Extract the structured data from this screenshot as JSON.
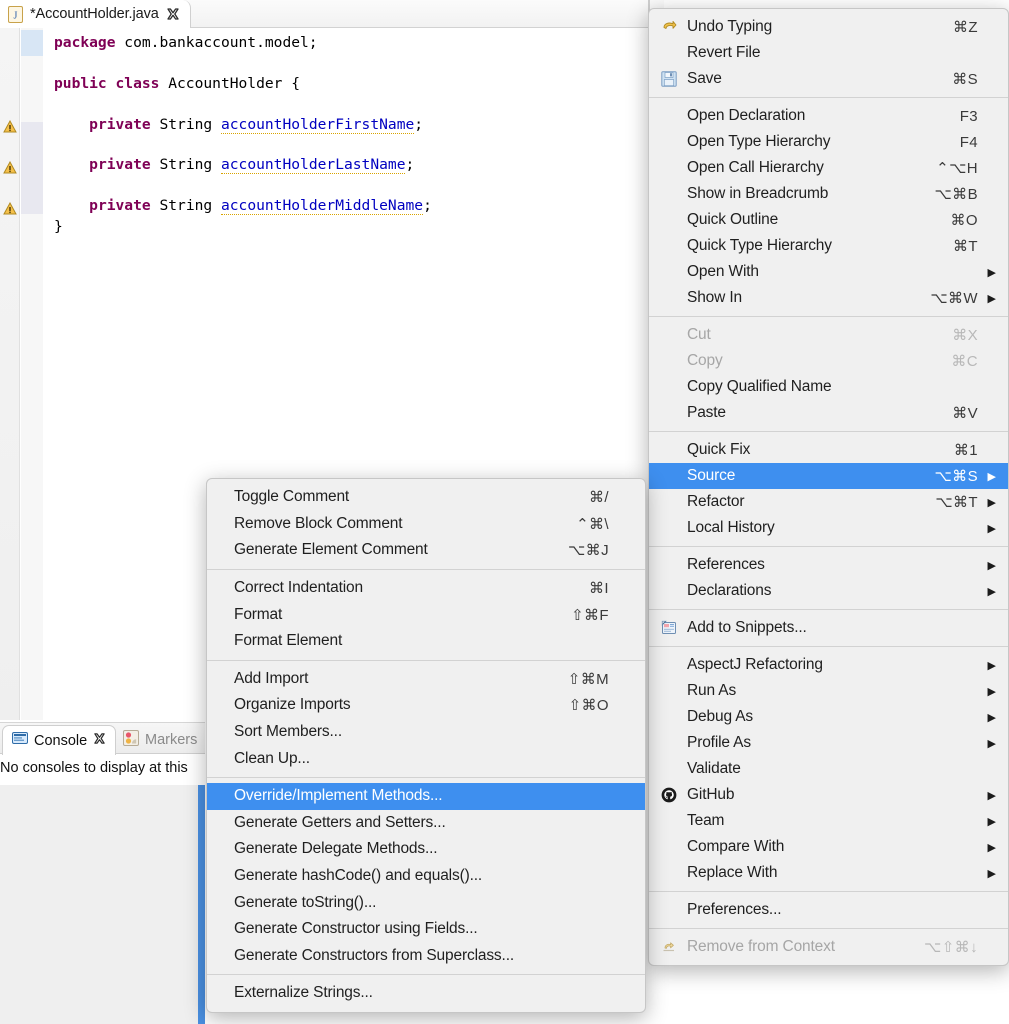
{
  "editor": {
    "tab": {
      "title": "*AccountHolder.java",
      "close_icon": "close-x-icon",
      "file_icon": "java-file-icon"
    },
    "code_lines": [
      {
        "id": "l1",
        "segments": [
          {
            "t": "kw",
            "s": "package"
          },
          {
            "t": "p",
            "s": " com.bankaccount.model;"
          }
        ]
      },
      {
        "id": "l2",
        "segments": []
      },
      {
        "id": "l3",
        "segments": [
          {
            "t": "kw",
            "s": "public class"
          },
          {
            "t": "p",
            "s": " AccountHolder {"
          }
        ]
      },
      {
        "id": "l4",
        "segments": []
      },
      {
        "id": "l5",
        "segments": [
          {
            "t": "p",
            "s": "    "
          },
          {
            "t": "kw",
            "s": "private"
          },
          {
            "t": "p",
            "s": " String "
          },
          {
            "t": "fld",
            "s": "accountHolderFirstName"
          },
          {
            "t": "p",
            "s": ";"
          }
        ]
      },
      {
        "id": "l6",
        "segments": []
      },
      {
        "id": "l7",
        "segments": [
          {
            "t": "p",
            "s": "    "
          },
          {
            "t": "kw",
            "s": "private"
          },
          {
            "t": "p",
            "s": " String "
          },
          {
            "t": "fld",
            "s": "accountHolderLastName"
          },
          {
            "t": "p",
            "s": ";"
          }
        ]
      },
      {
        "id": "l8",
        "segments": []
      },
      {
        "id": "l9",
        "segments": [
          {
            "t": "p",
            "s": "    "
          },
          {
            "t": "kw",
            "s": "private"
          },
          {
            "t": "p",
            "s": " String "
          },
          {
            "t": "fld",
            "s": "accountHolderMiddleName"
          },
          {
            "t": "p",
            "s": ";"
          }
        ]
      },
      {
        "id": "l10",
        "segments": [
          {
            "t": "p",
            "s": "}"
          }
        ]
      },
      {
        "id": "l11",
        "segments": []
      }
    ],
    "gutter_warnings": 3,
    "colors": {
      "keyword": "#7f0055",
      "field": "#0000c0",
      "current_line": "#e5eef9",
      "warning_underline": "#d9a400"
    }
  },
  "bottom_panel": {
    "tabs": [
      {
        "label": "Console",
        "icon": "console-icon",
        "active": true,
        "closable": true
      },
      {
        "label": "Markers",
        "icon": "markers-icon",
        "active": false,
        "closable": false
      }
    ],
    "message": "No consoles to display at this"
  },
  "context_menu": {
    "name": "editor-context-menu",
    "groups": [
      {
        "items": [
          {
            "label": "Undo Typing",
            "shortcut": "⌘Z",
            "icon": "undo-icon",
            "submenu": false,
            "disabled": false,
            "selected": false
          },
          {
            "label": "Revert File",
            "shortcut": "",
            "icon": "",
            "submenu": false,
            "disabled": false,
            "selected": false
          },
          {
            "label": "Save",
            "shortcut": "⌘S",
            "icon": "save-icon",
            "submenu": false,
            "disabled": false,
            "selected": false
          }
        ]
      },
      {
        "items": [
          {
            "label": "Open Declaration",
            "shortcut": "F3",
            "icon": "",
            "submenu": false,
            "disabled": false,
            "selected": false
          },
          {
            "label": "Open Type Hierarchy",
            "shortcut": "F4",
            "icon": "",
            "submenu": false,
            "disabled": false,
            "selected": false
          },
          {
            "label": "Open Call Hierarchy",
            "shortcut": "⌃⌥H",
            "icon": "",
            "submenu": false,
            "disabled": false,
            "selected": false
          },
          {
            "label": "Show in Breadcrumb",
            "shortcut": "⌥⌘B",
            "icon": "",
            "submenu": false,
            "disabled": false,
            "selected": false
          },
          {
            "label": "Quick Outline",
            "shortcut": "⌘O",
            "icon": "",
            "submenu": false,
            "disabled": false,
            "selected": false
          },
          {
            "label": "Quick Type Hierarchy",
            "shortcut": "⌘T",
            "icon": "",
            "submenu": false,
            "disabled": false,
            "selected": false
          },
          {
            "label": "Open With",
            "shortcut": "",
            "icon": "",
            "submenu": true,
            "disabled": false,
            "selected": false
          },
          {
            "label": "Show In",
            "shortcut": "⌥⌘W",
            "icon": "",
            "submenu": true,
            "disabled": false,
            "selected": false
          }
        ]
      },
      {
        "items": [
          {
            "label": "Cut",
            "shortcut": "⌘X",
            "icon": "",
            "submenu": false,
            "disabled": true,
            "selected": false
          },
          {
            "label": "Copy",
            "shortcut": "⌘C",
            "icon": "",
            "submenu": false,
            "disabled": true,
            "selected": false
          },
          {
            "label": "Copy Qualified Name",
            "shortcut": "",
            "icon": "",
            "submenu": false,
            "disabled": false,
            "selected": false
          },
          {
            "label": "Paste",
            "shortcut": "⌘V",
            "icon": "",
            "submenu": false,
            "disabled": false,
            "selected": false
          }
        ]
      },
      {
        "items": [
          {
            "label": "Quick Fix",
            "shortcut": "⌘1",
            "icon": "",
            "submenu": false,
            "disabled": false,
            "selected": false
          },
          {
            "label": "Source",
            "shortcut": "⌥⌘S",
            "icon": "",
            "submenu": true,
            "disabled": false,
            "selected": true
          },
          {
            "label": "Refactor",
            "shortcut": "⌥⌘T",
            "icon": "",
            "submenu": true,
            "disabled": false,
            "selected": false
          },
          {
            "label": "Local History",
            "shortcut": "",
            "icon": "",
            "submenu": true,
            "disabled": false,
            "selected": false
          }
        ]
      },
      {
        "items": [
          {
            "label": "References",
            "shortcut": "",
            "icon": "",
            "submenu": true,
            "disabled": false,
            "selected": false
          },
          {
            "label": "Declarations",
            "shortcut": "",
            "icon": "",
            "submenu": true,
            "disabled": false,
            "selected": false
          }
        ]
      },
      {
        "items": [
          {
            "label": "Add to Snippets...",
            "shortcut": "",
            "icon": "snippets-icon",
            "submenu": false,
            "disabled": false,
            "selected": false
          }
        ]
      },
      {
        "items": [
          {
            "label": "AspectJ Refactoring",
            "shortcut": "",
            "icon": "",
            "submenu": true,
            "disabled": false,
            "selected": false
          },
          {
            "label": "Run As",
            "shortcut": "",
            "icon": "",
            "submenu": true,
            "disabled": false,
            "selected": false
          },
          {
            "label": "Debug As",
            "shortcut": "",
            "icon": "",
            "submenu": true,
            "disabled": false,
            "selected": false
          },
          {
            "label": "Profile As",
            "shortcut": "",
            "icon": "",
            "submenu": true,
            "disabled": false,
            "selected": false
          },
          {
            "label": "Validate",
            "shortcut": "",
            "icon": "",
            "submenu": false,
            "disabled": false,
            "selected": false
          },
          {
            "label": "GitHub",
            "shortcut": "",
            "icon": "github-icon",
            "submenu": true,
            "disabled": false,
            "selected": false
          },
          {
            "label": "Team",
            "shortcut": "",
            "icon": "",
            "submenu": true,
            "disabled": false,
            "selected": false
          },
          {
            "label": "Compare With",
            "shortcut": "",
            "icon": "",
            "submenu": true,
            "disabled": false,
            "selected": false
          },
          {
            "label": "Replace With",
            "shortcut": "",
            "icon": "",
            "submenu": true,
            "disabled": false,
            "selected": false
          }
        ]
      },
      {
        "items": [
          {
            "label": "Preferences...",
            "shortcut": "",
            "icon": "",
            "submenu": false,
            "disabled": false,
            "selected": false
          }
        ]
      },
      {
        "items": [
          {
            "label": "Remove from Context",
            "shortcut": "⌥⇧⌘↓",
            "icon": "remove-context-icon",
            "submenu": false,
            "disabled": true,
            "selected": false
          }
        ]
      }
    ]
  },
  "source_submenu": {
    "name": "source-submenu",
    "groups": [
      {
        "items": [
          {
            "label": "Toggle Comment",
            "shortcut": "⌘/",
            "submenu": false,
            "disabled": false,
            "selected": false
          },
          {
            "label": "Remove Block Comment",
            "shortcut": "⌃⌘\\",
            "submenu": false,
            "disabled": false,
            "selected": false
          },
          {
            "label": "Generate Element Comment",
            "shortcut": "⌥⌘J",
            "submenu": false,
            "disabled": false,
            "selected": false
          }
        ]
      },
      {
        "items": [
          {
            "label": "Correct Indentation",
            "shortcut": "⌘I",
            "submenu": false,
            "disabled": false,
            "selected": false
          },
          {
            "label": "Format",
            "shortcut": "⇧⌘F",
            "submenu": false,
            "disabled": false,
            "selected": false
          },
          {
            "label": "Format Element",
            "shortcut": "",
            "submenu": false,
            "disabled": false,
            "selected": false
          }
        ]
      },
      {
        "items": [
          {
            "label": "Add Import",
            "shortcut": "⇧⌘M",
            "submenu": false,
            "disabled": false,
            "selected": false
          },
          {
            "label": "Organize Imports",
            "shortcut": "⇧⌘O",
            "submenu": false,
            "disabled": false,
            "selected": false
          },
          {
            "label": "Sort Members...",
            "shortcut": "",
            "submenu": false,
            "disabled": false,
            "selected": false
          },
          {
            "label": "Clean Up...",
            "shortcut": "",
            "submenu": false,
            "disabled": false,
            "selected": false
          }
        ]
      },
      {
        "items": [
          {
            "label": "Override/Implement Methods...",
            "shortcut": "",
            "submenu": false,
            "disabled": false,
            "selected": true
          },
          {
            "label": "Generate Getters and Setters...",
            "shortcut": "",
            "submenu": false,
            "disabled": false,
            "selected": false
          },
          {
            "label": "Generate Delegate Methods...",
            "shortcut": "",
            "submenu": false,
            "disabled": false,
            "selected": false
          },
          {
            "label": "Generate hashCode() and equals()...",
            "shortcut": "",
            "submenu": false,
            "disabled": false,
            "selected": false
          },
          {
            "label": "Generate toString()...",
            "shortcut": "",
            "submenu": false,
            "disabled": false,
            "selected": false
          },
          {
            "label": "Generate Constructor using Fields...",
            "shortcut": "",
            "submenu": false,
            "disabled": false,
            "selected": false
          },
          {
            "label": "Generate Constructors from Superclass...",
            "shortcut": "",
            "submenu": false,
            "disabled": false,
            "selected": false
          }
        ]
      },
      {
        "items": [
          {
            "label": "Externalize Strings...",
            "shortcut": "",
            "submenu": false,
            "disabled": false,
            "selected": false
          }
        ]
      }
    ]
  },
  "theme": {
    "menu_bg": "#f0f0f0",
    "menu_selected": "#3e8fef",
    "menu_text": "#1f1f1f",
    "menu_disabled": "#a6a6a6",
    "separator": "#d2d2d2"
  }
}
